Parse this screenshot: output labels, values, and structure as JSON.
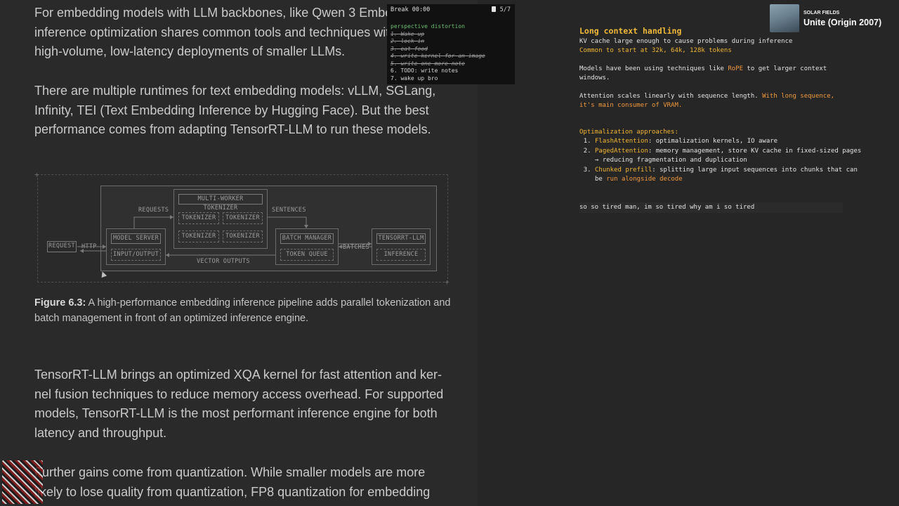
{
  "reader": {
    "paragraphs": [
      "For embedding models with LLM backbones, like Qwen 3 Embed 8B, inference optimization shares common tools and techniques with other high-volume, low-latency deployments of smaller LLMs.",
      "There are multiple runtimes for text embedding models: vLLM, SGLang, Infinity, TEI (Text Embedding Inference by Hugging Face). But the best performance comes from adapting TensorRT-LLM to run these models.",
      "TensorRT-LLM brings an optimized XQA kernel for fast attention and ker-nel fusion techniques to reduce memory access overhead. For supported models, TensorRT-LLM is the most performant inference engine for both latency and throughput.",
      "Further gains come from quantization. While smaller models are more likely to lose quality from quantization, FP8 quantization for embedding"
    ],
    "figure": {
      "caption_label": "Figure 6.3:",
      "caption_text": " A high-performance embedding inference pipeline adds parallel tokenization and batch management in front of an optimized inference engine.",
      "diagram": {
        "request": "REQUEST",
        "http": "HTTP",
        "requests": "REQUESTS",
        "sentences": "SENTENCES",
        "batches": "BATCHES",
        "vector_outputs": "VECTOR OUTPUTS",
        "model_server": "MODEL SERVER",
        "input_output": "INPUT/OUTPUT",
        "multi_worker_tokenizer": "MULTI-WORKER TOKENIZER",
        "tokenizer": "TOKENIZER",
        "batch_manager": "BATCH MANAGER",
        "token_queue": "TOKEN QUEUE",
        "tensorrt_llm": "TENSORRT-LLM",
        "inference": "INFERENCE"
      }
    }
  },
  "overlay": {
    "title": "Break 00:00",
    "page_count": "5/7",
    "items": [
      {
        "text": "perspective distortion",
        "style": "green"
      },
      {
        "text": "1. Wake up",
        "style": "strike"
      },
      {
        "text": "2. lock in",
        "style": "strike"
      },
      {
        "text": "3. eat food",
        "style": "strike"
      },
      {
        "text": "4. write kernel for an image",
        "style": "strike"
      },
      {
        "text": "5. write one more note",
        "style": "strike"
      },
      {
        "text": "6. TODO: write notes",
        "style": "plain"
      },
      {
        "text": "7. wake up bro",
        "style": "plain"
      }
    ]
  },
  "notes": {
    "heading": "Long context handling",
    "line1": "KV cache large enough to cause problems during inference",
    "line2": "Common to start at 32k, 64k, 128k tokens",
    "line3a": "Models have been using techniques like ",
    "line3_hl": "RoPE",
    "line3b": " to get larger context",
    "line3c": "windows.",
    "line4a": "Attention scales linearly with sequence length. ",
    "line4_hl": "With long sequence,",
    "line4c": "it's main consumer of VRAM.",
    "approaches_heading": "Optimalization approaches:",
    "approaches": [
      {
        "name": "FlashAttention",
        "rest": ": optimalization kernels, IO aware"
      },
      {
        "name": "PagedAttention",
        "rest": ": memory management, store KV cache in fixed-sized pages → reducing fragmentation and duplication"
      },
      {
        "name": "Chunked prefill",
        "rest": ": splitting large input sequences into chunks that can be ",
        "tail_hl": "run alongside decode"
      }
    ],
    "input_text": "so so tired man, im so tired why am i so tired"
  },
  "now_playing": {
    "artist": "SOLAR FIELDS",
    "title": "Unite (Origin 2007)"
  },
  "colors": {
    "background": "#262626",
    "accent_yellow": "#f2b634",
    "accent_orange": "#f19a3e",
    "note_green": "#6bbf73"
  }
}
